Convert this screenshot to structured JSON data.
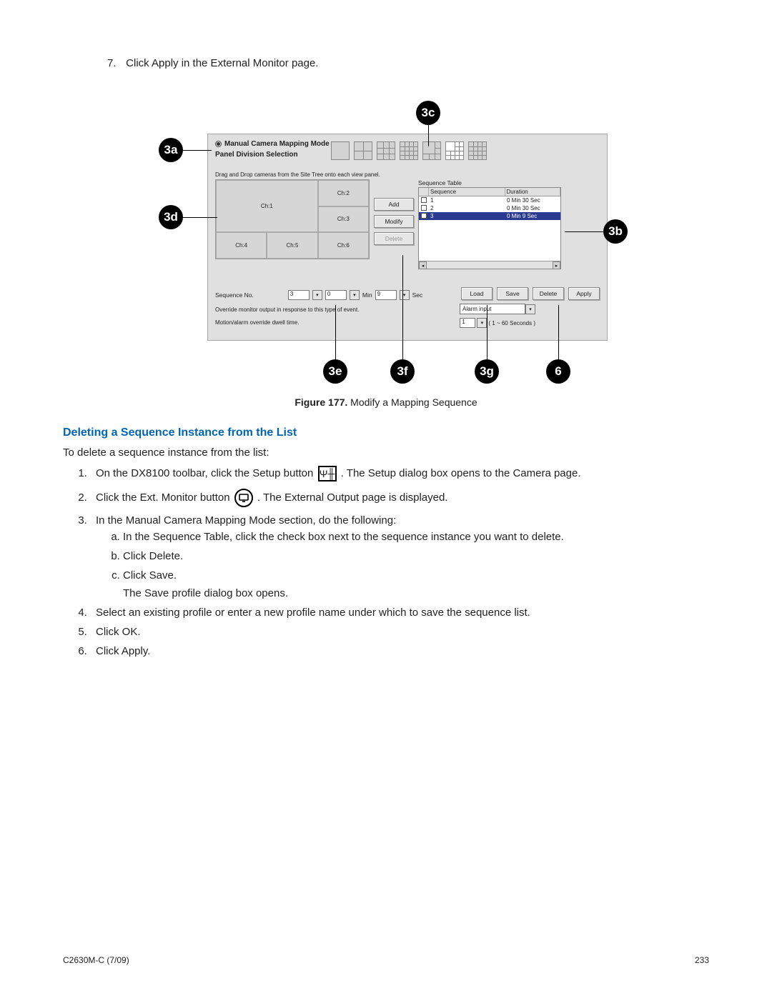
{
  "top_step": {
    "num": "7.",
    "text": "Click Apply in the External Monitor page."
  },
  "callouts": {
    "c3a": "3a",
    "c3b": "3b",
    "c3c": "3c",
    "c3d": "3d",
    "c3e": "3e",
    "c3f": "3f",
    "c3g": "3g",
    "c6": "6"
  },
  "dialog": {
    "mode_label": "Manual Camera Mapping Mode",
    "panel_division_label": "Panel Division Selection",
    "drag_instr": "Drag and Drop cameras from the Site Tree onto each view panel.",
    "view_cells": {
      "ch1": "Ch:1",
      "ch2": "Ch:2",
      "ch3": "Ch:3",
      "ch4": "Ch:4",
      "ch5": "Ch:5",
      "ch6": "Ch:6"
    },
    "btns": {
      "add": "Add",
      "modify": "Modify",
      "deleteSeq": "Delete"
    },
    "seq_table": {
      "title": "Sequence Table",
      "headers": {
        "seq": "Sequence",
        "dur": "Duration"
      },
      "rows": [
        {
          "n": "1",
          "d": "0 Min 30 Sec"
        },
        {
          "n": "2",
          "d": "0 Min 30 Sec"
        },
        {
          "n": "3",
          "d": "0 Min 9 Sec"
        }
      ]
    },
    "seq_no": {
      "label": "Sequence No.",
      "val": "3",
      "min": "0",
      "min_lbl": "Min",
      "sec": "9",
      "sec_lbl": "Sec"
    },
    "override_text": "Override monitor output in response to this type of event.",
    "dwell_text": "Motion/alarm override dwell time.",
    "right_btns": {
      "load": "Load",
      "save": "Save",
      "delete": "Delete",
      "apply": "Apply"
    },
    "alarm_input": "Alarm input",
    "sec_range": {
      "val": "1",
      "range": "( 1 ~ 60 Seconds )"
    }
  },
  "caption": {
    "prefix": "Figure 177.",
    "text": "  Modify a Mapping Sequence"
  },
  "section_heading": "Deleting a Sequence Instance from the List",
  "intro": "To delete a sequence instance from the list:",
  "steps": [
    {
      "pre": "On the DX8100 toolbar, click the Setup button ",
      "post": ". The Setup dialog box opens to the Camera page."
    },
    {
      "pre": "Click the Ext. Monitor button ",
      "post": ". The External Output page is displayed."
    },
    {
      "text": "In the Manual Camera Mapping Mode section, do the following:",
      "subs": [
        "In the Sequence Table, click the check box next to the sequence instance you want to delete.",
        "Click Delete.",
        "Click Save.",
        "The Save profile dialog box opens."
      ]
    },
    {
      "text": "Select an existing profile or enter a new profile name under which to save the sequence list."
    },
    {
      "text": "Click OK."
    },
    {
      "text": "Click Apply."
    }
  ],
  "footer": {
    "left": "C2630M-C (7/09)",
    "right": "233"
  }
}
